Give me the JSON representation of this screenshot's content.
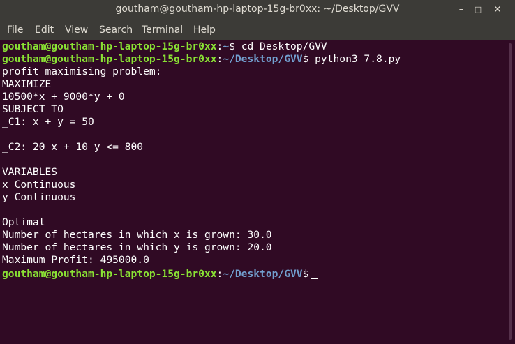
{
  "window": {
    "title": "goutham@goutham-hp-laptop-15g-br0xx: ~/Desktop/GVV",
    "minimize_glyph": "–",
    "maximize_glyph": "□",
    "close_glyph": "✕"
  },
  "menu": {
    "items": [
      "File",
      "Edit",
      "View",
      "Search",
      "Terminal",
      "Help"
    ]
  },
  "terminal": {
    "prompt_user": "goutham@goutham-hp-laptop-15g-br0xx",
    "lines": [
      {
        "path": "~",
        "command": "cd Desktop/GVV"
      },
      {
        "path": "~/Desktop/GVV",
        "command": "python3 7.8.py"
      },
      {
        "text": "profit_maximising_problem:"
      },
      {
        "text": "MAXIMIZE"
      },
      {
        "text": "10500*x + 9000*y + 0"
      },
      {
        "text": "SUBJECT TO"
      },
      {
        "text": "_C1: x + y = 50"
      },
      {
        "text": ""
      },
      {
        "text": "_C2: 20 x + 10 y <= 800"
      },
      {
        "text": ""
      },
      {
        "text": "VARIABLES"
      },
      {
        "text": "x Continuous"
      },
      {
        "text": "y Continuous"
      },
      {
        "text": ""
      },
      {
        "text": "Optimal"
      },
      {
        "text": "Number of hectares in which x is grown: 30.0"
      },
      {
        "text": "Number of hectares in which y is grown: 20.0"
      },
      {
        "text": "Maximum Profit: 495000.0"
      },
      {
        "path": "~/Desktop/GVV",
        "command": ""
      }
    ]
  },
  "colors": {
    "background": "#300a24",
    "prompt_user": "#8ae234",
    "prompt_path": "#729fcf",
    "text": "#ffffff",
    "chrome": "#3c3b37"
  }
}
